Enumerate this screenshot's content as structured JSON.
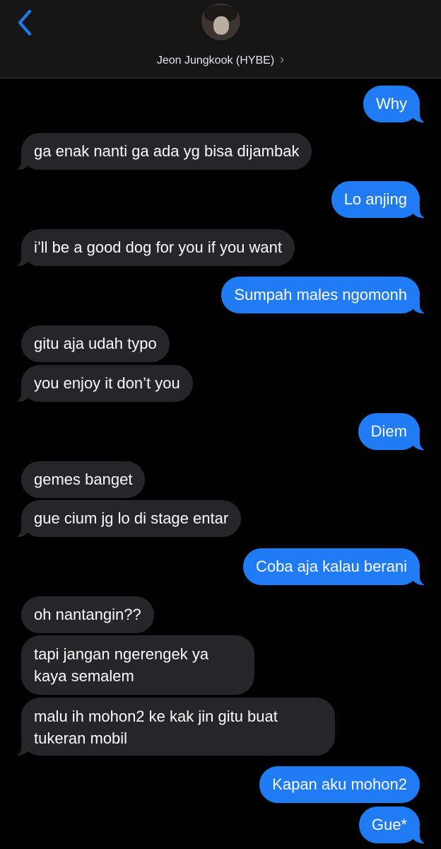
{
  "header": {
    "back_icon": "chevron-left-icon",
    "contact_name": "Jeon Jungkook (HYBE)",
    "contact_chevron": "›",
    "accent_color": "#1f7cf4"
  },
  "messages": [
    {
      "from": "me",
      "text": "Why"
    },
    {
      "from": "them",
      "text": "ga enak nanti ga ada yg bisa dijambak"
    },
    {
      "from": "me",
      "text": "Lo anjing"
    },
    {
      "from": "them",
      "text": "i’ll be a good dog for you if you want"
    },
    {
      "from": "me",
      "text": "Sumpah males ngomonh"
    },
    {
      "from": "them",
      "text": "gitu aja udah typo"
    },
    {
      "from": "them",
      "text": "you enjoy it don’t you"
    },
    {
      "from": "me",
      "text": "Diem"
    },
    {
      "from": "them",
      "text": "gemes banget"
    },
    {
      "from": "them",
      "text": "gue cium jg lo di stage entar"
    },
    {
      "from": "me",
      "text": "Coba aja kalau berani"
    },
    {
      "from": "them",
      "text": "oh nantangin??"
    },
    {
      "from": "them",
      "text": "tapi jangan ngerengek ya kaya semalem"
    },
    {
      "from": "them",
      "text": "malu ih mohon2 ke kak jin gitu buat tukeran mobil"
    },
    {
      "from": "me",
      "text": "Kapan aku mohon2"
    },
    {
      "from": "me",
      "text": "Gue*"
    }
  ]
}
